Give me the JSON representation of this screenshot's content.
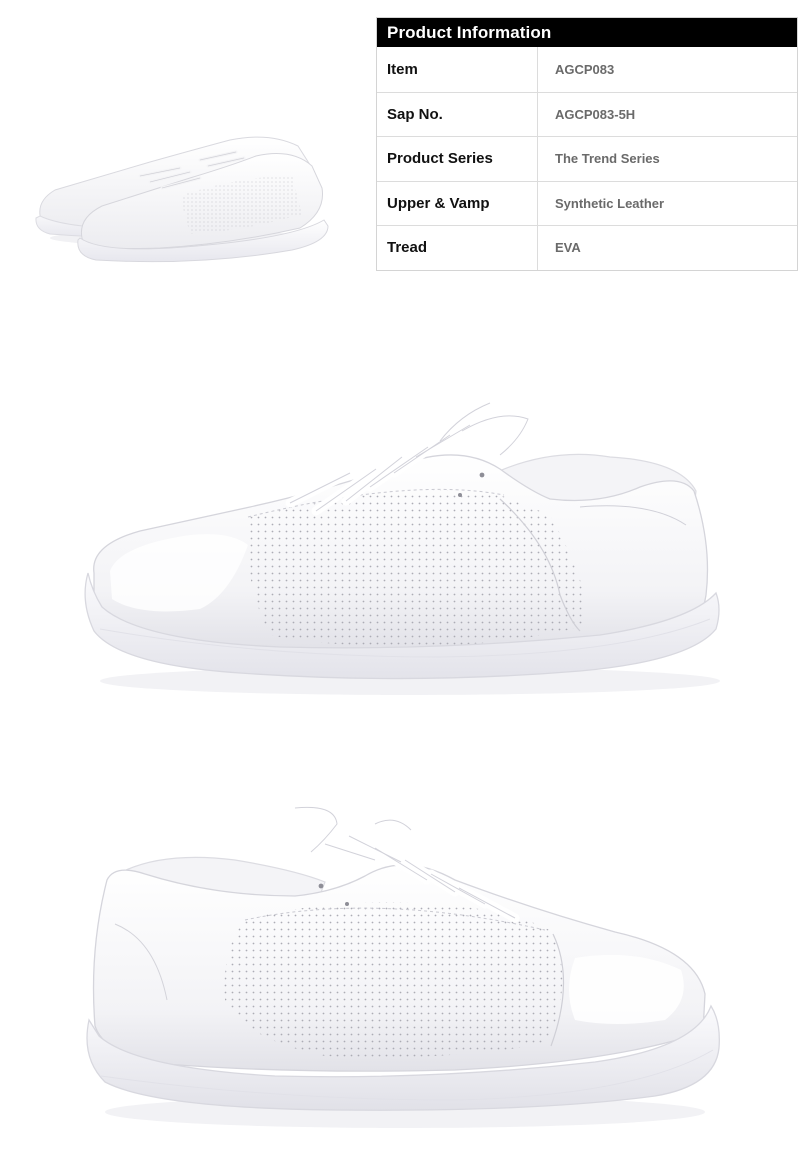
{
  "product_info": {
    "header": "Product Information",
    "rows": [
      {
        "label": "Item",
        "value": "AGCP083"
      },
      {
        "label": "Sap No.",
        "value": "AGCP083-5H"
      },
      {
        "label": "Product Series",
        "value": "The Trend Series"
      },
      {
        "label": "Upper & Vamp",
        "value": "Synthetic Leather"
      },
      {
        "label": "Tread",
        "value": "EVA"
      }
    ]
  },
  "images": {
    "pair_thumbnail": "white sneaker pair",
    "side_view_right": "white sneaker lateral view",
    "side_view_left": "white sneaker medial view"
  }
}
